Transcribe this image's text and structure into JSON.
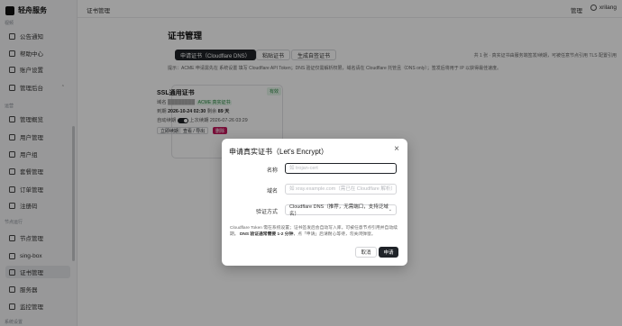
{
  "app": {
    "name": "轻舟服务"
  },
  "sidebar": {
    "sections": [
      {
        "label": "视频"
      },
      {
        "label": "运营"
      },
      {
        "label": "节点运行"
      },
      {
        "label": "系统设置"
      }
    ],
    "items": [
      {
        "label": "公告通知"
      },
      {
        "label": "帮助中心"
      },
      {
        "label": "账户设置"
      },
      {
        "label": "管理后台"
      },
      {
        "label": "管理概览"
      },
      {
        "label": "用户管理"
      },
      {
        "label": "用户组"
      },
      {
        "label": "套餐管理"
      },
      {
        "label": "订单管理"
      },
      {
        "label": "注册码"
      },
      {
        "label": "节点管理"
      },
      {
        "label": "sing-box"
      },
      {
        "label": "证书管理"
      },
      {
        "label": "服务器"
      },
      {
        "label": "监控管理"
      }
    ]
  },
  "topbar": {
    "title": "证书管理",
    "manage": "管理",
    "user": "xrilang"
  },
  "page": {
    "title": "证书管理",
    "buttons": {
      "apply": "申请证书（Cloudflare DNS）",
      "paste": "粘贴证书",
      "self_signed": "生成自签证书"
    },
    "description": "提示：ACME 申请需先在 系统设置 填写 Cloudflare API Token；DNS 验证仅需解析权限，域名请在 Cloudflare 托管且（DNS only）；签发后将用于 IP 以获得最佳速度。",
    "right_hint": "共 1 张 · 真实证书由服务端签发/续期，可被任意节点引用 TLS 配置引用"
  },
  "cert_card": {
    "title": "SSL通用证书",
    "status": "有效",
    "domain_label": "域名",
    "domain_value": "████████",
    "acme_tag": "ACME 真实证书",
    "expiry_label": "到期",
    "expiry_value": "2026-10-24 02:30",
    "remaining_label": "剩余",
    "remaining_value": "89 天",
    "auto_renew_label": "自动续期",
    "last_renew_label": "上次续期",
    "last_renew_value": "2026-07-26 03:29",
    "btn_renew": "立即续期",
    "btn_view": "查看 / 导出",
    "btn_delete": "删除"
  },
  "modal": {
    "title": "申请真实证书（Let's Encrypt）",
    "name_label": "名称",
    "name_placeholder": "如 trojan-cert",
    "domain_label": "域名",
    "domain_placeholder": "如 xray.example.com（需已在 Cloudflare 解析）",
    "method_label": "验证方式",
    "method_value": "Cloudflare DNS（推荐，无需端口，支持泛域名）",
    "note_1": "Cloudflare Token 需在系统设置；证书签发后会自动写入库，可被任意节点引用并自动续期。",
    "note_bold": "DNS 验证通常需要 1-2 分钟",
    "note_2": "，点「申请」后请耐心等待，勿关闭弹窗。",
    "cancel": "取消",
    "submit": "申请"
  }
}
